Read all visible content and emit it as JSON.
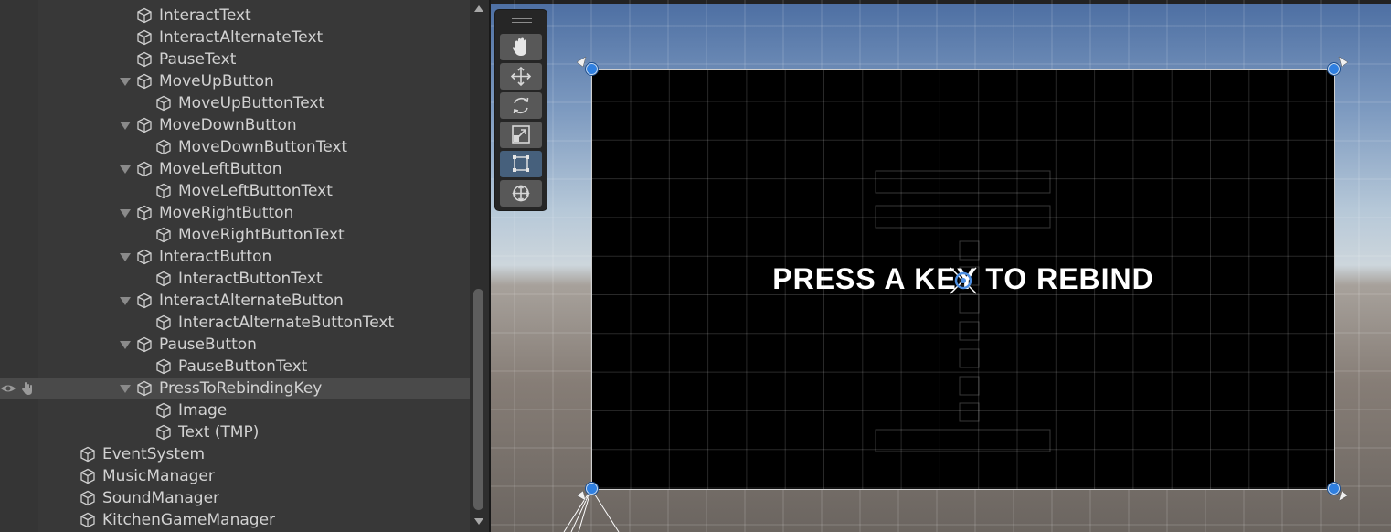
{
  "hierarchy": {
    "items": [
      {
        "label": "InteractText",
        "depth": 3,
        "expandable": false
      },
      {
        "label": "InteractAlternateText",
        "depth": 3,
        "expandable": false
      },
      {
        "label": "PauseText",
        "depth": 3,
        "expandable": false
      },
      {
        "label": "MoveUpButton",
        "depth": 3,
        "expandable": true
      },
      {
        "label": "MoveUpButtonText",
        "depth": 4,
        "expandable": false
      },
      {
        "label": "MoveDownButton",
        "depth": 3,
        "expandable": true
      },
      {
        "label": "MoveDownButtonText",
        "depth": 4,
        "expandable": false
      },
      {
        "label": "MoveLeftButton",
        "depth": 3,
        "expandable": true
      },
      {
        "label": "MoveLeftButtonText",
        "depth": 4,
        "expandable": false
      },
      {
        "label": "MoveRightButton",
        "depth": 3,
        "expandable": true
      },
      {
        "label": "MoveRightButtonText",
        "depth": 4,
        "expandable": false
      },
      {
        "label": "InteractButton",
        "depth": 3,
        "expandable": true
      },
      {
        "label": "InteractButtonText",
        "depth": 4,
        "expandable": false
      },
      {
        "label": "InteractAlternateButton",
        "depth": 3,
        "expandable": true
      },
      {
        "label": "InteractAlternateButtonText",
        "depth": 4,
        "expandable": false
      },
      {
        "label": "PauseButton",
        "depth": 3,
        "expandable": true
      },
      {
        "label": "PauseButtonText",
        "depth": 4,
        "expandable": false
      },
      {
        "label": "PressToRebindingKey",
        "depth": 3,
        "expandable": true,
        "selected": true
      },
      {
        "label": "Image",
        "depth": 4,
        "expandable": false
      },
      {
        "label": "Text (TMP)",
        "depth": 4,
        "expandable": false
      },
      {
        "label": "EventSystem",
        "depth": 1,
        "expandable": false
      },
      {
        "label": "MusicManager",
        "depth": 1,
        "expandable": false
      },
      {
        "label": "SoundManager",
        "depth": 1,
        "expandable": false
      },
      {
        "label": "KitchenGameManager",
        "depth": 1,
        "expandable": false
      }
    ]
  },
  "scene": {
    "canvas_text": "PRESS A KEY TO REBIND",
    "tools": [
      {
        "name": "hand-tool",
        "icon": "hand-icon",
        "active": false
      },
      {
        "name": "move-tool",
        "icon": "move-arrows-icon",
        "active": false
      },
      {
        "name": "rotate-tool",
        "icon": "rotate-icon",
        "active": false
      },
      {
        "name": "scale-tool",
        "icon": "scale-icon",
        "active": false
      },
      {
        "name": "rect-tool",
        "icon": "rect-transform-icon",
        "active": true
      },
      {
        "name": "transform-tool",
        "icon": "transform-icon",
        "active": false
      }
    ]
  },
  "colors": {
    "panel_bg": "#383838",
    "selection_bg": "#4a4a4a",
    "text": "#d2d2d2",
    "handle_blue": "#2f7fe0",
    "active_tool": "#46607c"
  }
}
